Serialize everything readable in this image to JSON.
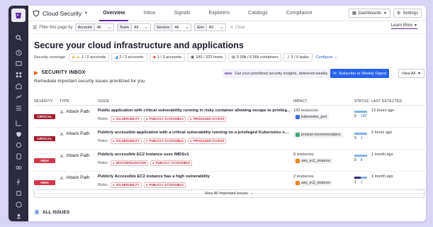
{
  "app": {
    "title": "Cloud Security"
  },
  "nav": {
    "tabs": [
      {
        "label": "Overview",
        "active": true
      },
      {
        "label": "Inbox"
      },
      {
        "label": "Signals"
      },
      {
        "label": "Explorers"
      },
      {
        "label": "Catalogs"
      },
      {
        "label": "Compliance"
      }
    ]
  },
  "toolbar": {
    "dashboards_label": "Dashboards",
    "settings_label": "Settings"
  },
  "filters": {
    "prefix": "Filter this page by",
    "items": [
      {
        "key": "Account",
        "value": "All"
      },
      {
        "key": "Team",
        "value": "All"
      },
      {
        "key": "Service",
        "value": "All"
      },
      {
        "key": "Env",
        "value": "All"
      }
    ],
    "clear_label": "Clear",
    "learn_more": "Learn More"
  },
  "page": {
    "title": "Secure your cloud infrastructure and applications"
  },
  "coverage": {
    "label": "Security coverage",
    "items": [
      {
        "text": "1 / 2 accounts",
        "icon": "aws-icon",
        "warn": true
      },
      {
        "text": "2 / 2 accounts",
        "icon": "azure-icon"
      },
      {
        "text": "1 / 3 accounts",
        "icon": "gcp-icon"
      },
      {
        "text": "180 / 323 hosts",
        "icon": "host-icon"
      },
      {
        "text": "5.99k / 6.56k containers",
        "icon": "container-icon"
      },
      {
        "text": "3 / 6 tasks",
        "icon": "task-icon"
      }
    ],
    "configure_label": "Configure"
  },
  "inbox": {
    "title": "SECURITY INBOX",
    "subtitle": "Remediate important security issues prioritized for you",
    "promo_badge": "NEW",
    "promo_text": "Get your prioritized security insights, delivered weekly",
    "subscribe_label": "Subscribe to Weekly Digest",
    "view_all_label": "View All"
  },
  "table": {
    "headers": [
      "SEVERITY",
      "TYPE",
      "ISSUE",
      "IMPACT",
      "STATUS",
      "LAST DETECTED"
    ],
    "rows": [
      {
        "severity": "CRITICAL",
        "sev_class": "crit",
        "type": "Attack Path",
        "issue": "Public application with critical vulnerability running in risky container allowing escape to privileg...",
        "risks_label": "Risks:",
        "risks": [
          "VULNERABILITY",
          "PUBLICLY ACCESSIBLE",
          "PRIVILEGED ACCESS"
        ],
        "impact_count": "120 resources",
        "impact_resource": "kubernetes_pod",
        "status_left": "0",
        "status_right": "120",
        "last": "13 hours ago"
      },
      {
        "severity": "CRITICAL",
        "sev_class": "crit",
        "type": "Attack Path",
        "issue": "Publicly accessible application with a critical vulnerability running on a privileged Kubernetes node",
        "risks_label": "Risks:",
        "risks": [
          "VULNERABILITY",
          "PUBLICLY ACCESSIBLE",
          "PRIVILEGED ACCESS"
        ],
        "impact_count": "",
        "impact_resource": "product-recommendation",
        "status_left": "0",
        "status_right": "1",
        "last": "2 hours ago"
      },
      {
        "severity": "HIGH",
        "sev_class": "high",
        "type": "Attack Path",
        "issue": "Publicly accessible EC2 instance uses IMDSv1",
        "risks_label": "Risks:",
        "risks": [
          "MISCONFIGURATION",
          "PUBLICLY ACCESSIBLE"
        ],
        "impact_count": "8 resources",
        "impact_resource": "aws_ec2_instance",
        "status_left": "0",
        "status_right": "8",
        "last": "1 month ago"
      },
      {
        "severity": "HIGH",
        "sev_class": "high",
        "type": "Attack Path",
        "issue": "Publicly Accessible EC2 instance has a high vulnerability",
        "risks_label": "Risks:",
        "risks": [
          "VULNERABILITY",
          "PUBLICLY ACCESSIBLE"
        ],
        "impact_count": "2 resources",
        "impact_resource": "aws_ec2_instance",
        "status_left": "1",
        "status_right": "1",
        "last": "1 month ago"
      }
    ]
  },
  "view_all_issues_label": "View All Important Issues",
  "all_issues_title": "ALL ISSUES"
}
